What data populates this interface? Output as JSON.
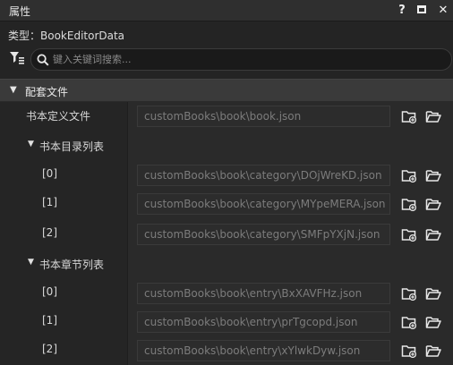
{
  "window": {
    "title": "属性",
    "help_label": "?",
    "close_label": "✕"
  },
  "type_line": "类型：BookEditorData",
  "search": {
    "placeholder": "键入关键词搜索..."
  },
  "section": {
    "label": "配套文件"
  },
  "rows": [
    {
      "kind": "field",
      "label": "书本定义文件",
      "value": "customBooks\\book\\book.json"
    },
    {
      "kind": "group",
      "label": "书本目录列表"
    },
    {
      "kind": "field",
      "label": "[0]",
      "value": "customBooks\\book\\category\\DOjWreKD.json"
    },
    {
      "kind": "field",
      "label": "[1]",
      "value": "customBooks\\book\\category\\MYpeMERA.json"
    },
    {
      "kind": "field",
      "label": "[2]",
      "value": "customBooks\\book\\category\\SMFpYXjN.json"
    },
    {
      "kind": "group",
      "label": "书本章节列表"
    },
    {
      "kind": "field",
      "label": "[0]",
      "value": "customBooks\\book\\entry\\BxXAVFHz.json"
    },
    {
      "kind": "field",
      "label": "[1]",
      "value": "customBooks\\book\\entry\\prTgcopd.json"
    },
    {
      "kind": "field",
      "label": "[2]",
      "value": "customBooks\\book\\entry\\xYlwkDyw.json"
    }
  ],
  "icons": {
    "filter": "filter-icon",
    "search": "search-icon",
    "new_file": "new-folder-icon",
    "open_folder": "open-folder-icon"
  }
}
